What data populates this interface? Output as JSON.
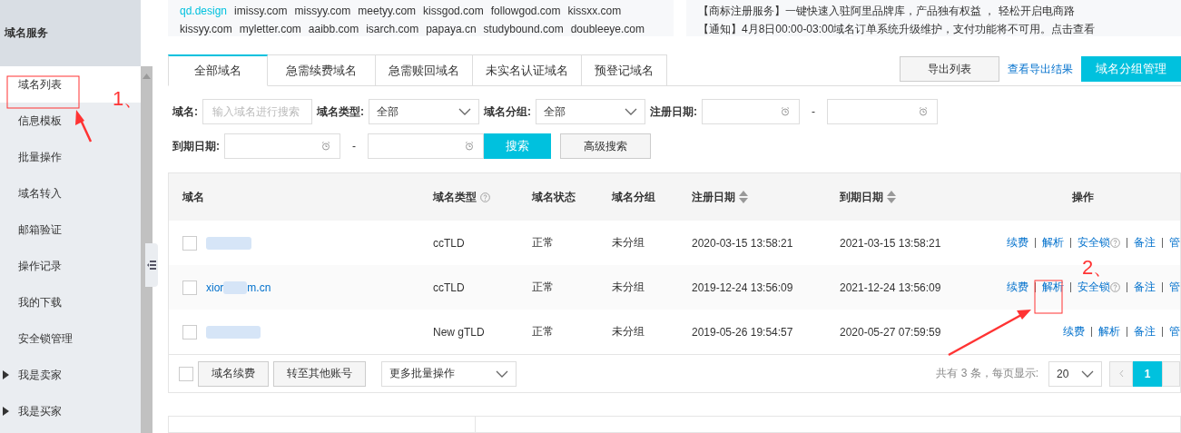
{
  "sidebar": {
    "title": "域名服务",
    "items": [
      {
        "label": "域名列表",
        "selected": true,
        "kind": "link"
      },
      {
        "label": "信息模板",
        "selected": false,
        "kind": "link"
      },
      {
        "label": "批量操作",
        "selected": false,
        "kind": "link"
      },
      {
        "label": "域名转入",
        "selected": false,
        "kind": "link"
      },
      {
        "label": "邮箱验证",
        "selected": false,
        "kind": "link"
      },
      {
        "label": "操作记录",
        "selected": false,
        "kind": "link"
      },
      {
        "label": "我的下载",
        "selected": false,
        "kind": "link"
      },
      {
        "label": "安全锁管理",
        "selected": false,
        "kind": "link"
      },
      {
        "label": "我是卖家",
        "selected": false,
        "kind": "group",
        "expanded": false
      },
      {
        "label": "我是买家",
        "selected": false,
        "kind": "group",
        "expanded": false
      }
    ]
  },
  "promo_domains": [
    [
      {
        "text": "qd.design",
        "highlighted": true
      },
      {
        "text": "imissy.com",
        "highlighted": false
      },
      {
        "text": "missyy.com",
        "highlighted": false
      },
      {
        "text": "meetyy.com",
        "highlighted": false
      },
      {
        "text": "kissgod.com",
        "highlighted": false
      },
      {
        "text": "followgod.com",
        "highlighted": false
      },
      {
        "text": "kissxx.com",
        "highlighted": false
      }
    ],
    [
      {
        "text": "kissyy.com",
        "highlighted": false
      },
      {
        "text": "myletter.com",
        "highlighted": false
      },
      {
        "text": "aaibb.com",
        "highlighted": false
      },
      {
        "text": "isarch.com",
        "highlighted": false
      },
      {
        "text": "papaya.cn",
        "highlighted": false
      },
      {
        "text": "studybound.com",
        "highlighted": false
      },
      {
        "text": "doubleeye.com",
        "highlighted": false
      }
    ]
  ],
  "notices": [
    "【商标注册服务】一键快速入驻阿里品牌库，产品独有权益 ， 轻松开启电商路",
    "【通知】4月8日00:00-03:00域名订单系统升级维护，支付功能将不可用。点击查看"
  ],
  "tabs": [
    {
      "label": "全部域名",
      "selected": true
    },
    {
      "label": "急需续费域名",
      "selected": false
    },
    {
      "label": "急需赎回域名",
      "selected": false
    },
    {
      "label": "未实名认证域名",
      "selected": false
    },
    {
      "label": "预登记域名",
      "selected": false
    }
  ],
  "toolbar": {
    "export_button": "导出列表",
    "export_link": "查看导出结果",
    "group_button": "域名分组管理"
  },
  "filters": {
    "domain_label": "域名:",
    "domain_placeholder": "输入域名进行搜索",
    "type_label": "域名类型:",
    "type_value": "全部",
    "group_label": "域名分组:",
    "group_value": "全部",
    "reg_label": "注册日期:",
    "exp_label": "到期日期:",
    "range_sep": "-",
    "search_button": "搜索",
    "advanced_button": "高级搜索"
  },
  "table": {
    "columns": [
      {
        "label": "域名",
        "kind": "plain"
      },
      {
        "label": "域名类型",
        "kind": "help"
      },
      {
        "label": "域名状态",
        "kind": "plain"
      },
      {
        "label": "域名分组",
        "kind": "plain"
      },
      {
        "label": "注册日期",
        "kind": "sort"
      },
      {
        "label": "到期日期",
        "kind": "sort"
      },
      {
        "label": "操作",
        "kind": "plain"
      }
    ],
    "rows": [
      {
        "checked": false,
        "domain_start": "",
        "domain_end": "",
        "type": "ccTLD",
        "status": "正常",
        "group": "未分组",
        "registered": "2020-03-15 13:58:21",
        "expires": "2021-03-15 13:58:21",
        "actions": [
          {
            "text": "续费",
            "kind": "link"
          },
          {
            "text": "解析",
            "kind": "link"
          },
          {
            "text": "安全锁",
            "kind": "help"
          },
          {
            "text": "备注",
            "kind": "link"
          },
          {
            "text": "管",
            "kind": "link"
          }
        ]
      },
      {
        "checked": false,
        "domain_start": "xior",
        "domain_end": "m.cn",
        "type": "ccTLD",
        "status": "正常",
        "group": "未分组",
        "registered": "2019-12-24 13:56:09",
        "expires": "2021-12-24 13:56:09",
        "actions": [
          {
            "text": "续费",
            "kind": "link"
          },
          {
            "text": "解析",
            "kind": "link"
          },
          {
            "text": "安全锁",
            "kind": "help"
          },
          {
            "text": "备注",
            "kind": "link"
          },
          {
            "text": "管",
            "kind": "link"
          }
        ]
      },
      {
        "checked": false,
        "domain_start": "",
        "domain_end": "",
        "type": "New gTLD",
        "status": "正常",
        "group": "未分组",
        "registered": "2019-05-26 19:54:57",
        "expires": "2020-05-27 07:59:59",
        "actions": [
          {
            "text": "续费",
            "kind": "link"
          },
          {
            "text": "解析",
            "kind": "link"
          },
          {
            "text": "备注",
            "kind": "link"
          },
          {
            "text": "管",
            "kind": "link"
          }
        ]
      }
    ]
  },
  "footer": {
    "select_all_checked": false,
    "renew_button": "域名续费",
    "transfer_button": "转至其他账号",
    "batch_select": "更多批量操作",
    "total_text": "共有 3 条，每页显示:",
    "page_size": "20",
    "pages": [
      {
        "label": "1",
        "selected": true
      }
    ]
  },
  "annotations": [
    {
      "label": "1、"
    },
    {
      "label": "2、"
    }
  ]
}
